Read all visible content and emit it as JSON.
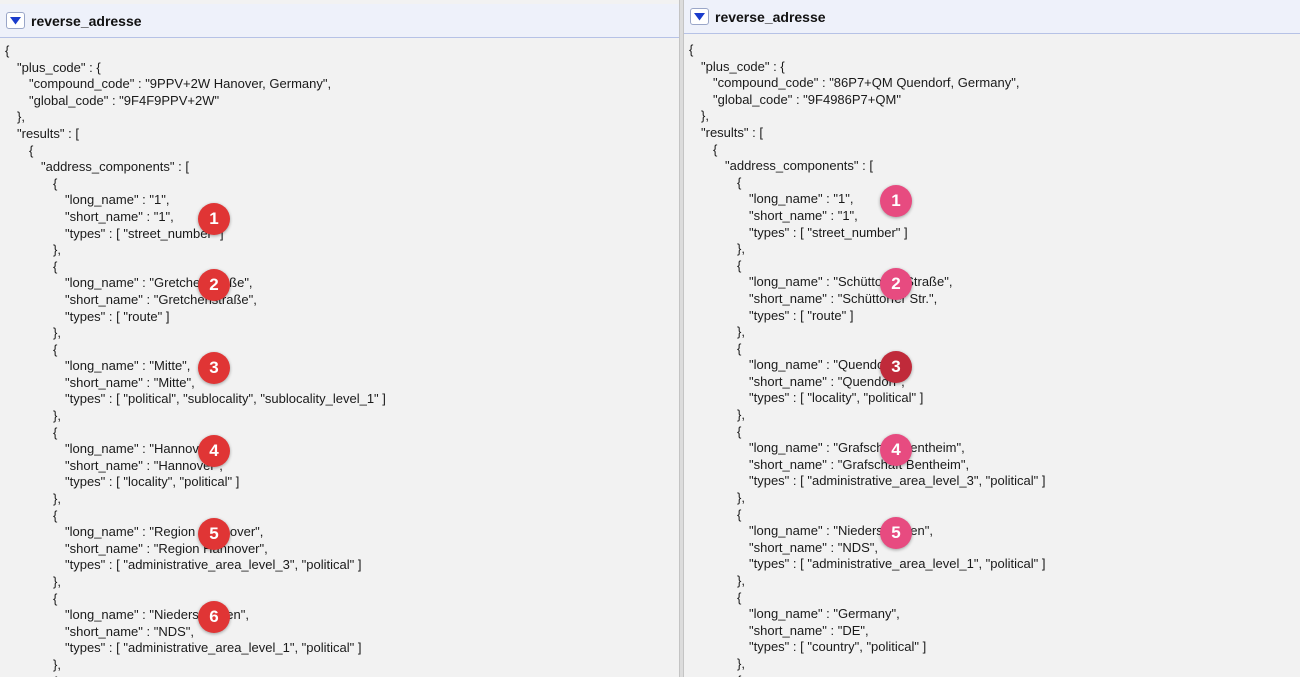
{
  "colors": {
    "marker_left": "#e03535",
    "marker_right": "#e74b80",
    "marker_right_active": "#c02a3a",
    "header_bg": "#eef1fa",
    "header_border": "#b6c2e6",
    "toggle_arrow": "#1a3ccc"
  },
  "panes": [
    {
      "title": "reverse_adresse",
      "toggle_icon": "triangle-down-icon",
      "lines": [
        {
          "indent": 0,
          "text": "{"
        },
        {
          "indent": 1,
          "text": "\"plus_code\" : {"
        },
        {
          "indent": 2,
          "text": "\"compound_code\" : \"9PPV+2W Hanover, Germany\","
        },
        {
          "indent": 2,
          "text": "\"global_code\" : \"9F4F9PPV+2W\""
        },
        {
          "indent": 1,
          "text": "},"
        },
        {
          "indent": 1,
          "text": "\"results\" : ["
        },
        {
          "indent": 2,
          "text": "{"
        },
        {
          "indent": 3,
          "text": "\"address_components\" : ["
        },
        {
          "indent": 4,
          "text": "{"
        },
        {
          "indent": 5,
          "text": "\"long_name\" : \"1\","
        },
        {
          "indent": 5,
          "text": "\"short_name\" : \"1\","
        },
        {
          "indent": 5,
          "text": "\"types\" : [ \"street_number\" ]"
        },
        {
          "indent": 4,
          "text": "},"
        },
        {
          "indent": 4,
          "text": "{"
        },
        {
          "indent": 5,
          "text": "\"long_name\" : \"Gretchenstraße\","
        },
        {
          "indent": 5,
          "text": "\"short_name\" : \"Gretchenstraße\","
        },
        {
          "indent": 5,
          "text": "\"types\" : [ \"route\" ]"
        },
        {
          "indent": 4,
          "text": "},"
        },
        {
          "indent": 4,
          "text": "{"
        },
        {
          "indent": 5,
          "text": "\"long_name\" : \"Mitte\","
        },
        {
          "indent": 5,
          "text": "\"short_name\" : \"Mitte\","
        },
        {
          "indent": 5,
          "text": "\"types\" : [ \"political\", \"sublocality\", \"sublocality_level_1\" ]"
        },
        {
          "indent": 4,
          "text": "},"
        },
        {
          "indent": 4,
          "text": "{"
        },
        {
          "indent": 5,
          "text": "\"long_name\" : \"Hannover\","
        },
        {
          "indent": 5,
          "text": "\"short_name\" : \"Hannover\","
        },
        {
          "indent": 5,
          "text": "\"types\" : [ \"locality\", \"political\" ]"
        },
        {
          "indent": 4,
          "text": "},"
        },
        {
          "indent": 4,
          "text": "{"
        },
        {
          "indent": 5,
          "text": "\"long_name\" : \"Region Hannover\","
        },
        {
          "indent": 5,
          "text": "\"short_name\" : \"Region Hannover\","
        },
        {
          "indent": 5,
          "text": "\"types\" : [ \"administrative_area_level_3\", \"political\" ]"
        },
        {
          "indent": 4,
          "text": "},"
        },
        {
          "indent": 4,
          "text": "{"
        },
        {
          "indent": 5,
          "text": "\"long_name\" : \"Niedersachsen\","
        },
        {
          "indent": 5,
          "text": "\"short_name\" : \"NDS\","
        },
        {
          "indent": 5,
          "text": "\"types\" : [ \"administrative_area_level_1\", \"political\" ]"
        },
        {
          "indent": 4,
          "text": "},"
        },
        {
          "indent": 4,
          "text": "{"
        }
      ],
      "markers": [
        {
          "label": "1",
          "line": 10
        },
        {
          "label": "2",
          "line": 14
        },
        {
          "label": "3",
          "line": 19
        },
        {
          "label": "4",
          "line": 24
        },
        {
          "label": "5",
          "line": 29
        },
        {
          "label": "6",
          "line": 34
        }
      ]
    },
    {
      "title": "reverse_adresse",
      "toggle_icon": "triangle-down-icon",
      "lines": [
        {
          "indent": 0,
          "text": "{"
        },
        {
          "indent": 1,
          "text": "\"plus_code\" : {"
        },
        {
          "indent": 2,
          "text": "\"compound_code\" : \"86P7+QM Quendorf, Germany\","
        },
        {
          "indent": 2,
          "text": "\"global_code\" : \"9F4986P7+QM\""
        },
        {
          "indent": 1,
          "text": "},"
        },
        {
          "indent": 1,
          "text": "\"results\" : ["
        },
        {
          "indent": 2,
          "text": "{"
        },
        {
          "indent": 3,
          "text": "\"address_components\" : ["
        },
        {
          "indent": 4,
          "text": "{"
        },
        {
          "indent": 5,
          "text": "\"long_name\" : \"1\","
        },
        {
          "indent": 5,
          "text": "\"short_name\" : \"1\","
        },
        {
          "indent": 5,
          "text": "\"types\" : [ \"street_number\" ]"
        },
        {
          "indent": 4,
          "text": "},"
        },
        {
          "indent": 4,
          "text": "{"
        },
        {
          "indent": 5,
          "text": "\"long_name\" : \"Schüttorfer Straße\","
        },
        {
          "indent": 5,
          "text": "\"short_name\" : \"Schüttorfer Str.\","
        },
        {
          "indent": 5,
          "text": "\"types\" : [ \"route\" ]"
        },
        {
          "indent": 4,
          "text": "},"
        },
        {
          "indent": 4,
          "text": "{"
        },
        {
          "indent": 5,
          "text": "\"long_name\" : \"Quendorf\","
        },
        {
          "indent": 5,
          "text": "\"short_name\" : \"Quendorf\","
        },
        {
          "indent": 5,
          "text": "\"types\" : [ \"locality\", \"political\" ]"
        },
        {
          "indent": 4,
          "text": "},"
        },
        {
          "indent": 4,
          "text": "{"
        },
        {
          "indent": 5,
          "text": "\"long_name\" : \"Grafschaft Bentheim\","
        },
        {
          "indent": 5,
          "text": "\"short_name\" : \"Grafschaft Bentheim\","
        },
        {
          "indent": 5,
          "text": "\"types\" : [ \"administrative_area_level_3\", \"political\" ]"
        },
        {
          "indent": 4,
          "text": "},"
        },
        {
          "indent": 4,
          "text": "{"
        },
        {
          "indent": 5,
          "text": "\"long_name\" : \"Niedersachsen\","
        },
        {
          "indent": 5,
          "text": "\"short_name\" : \"NDS\","
        },
        {
          "indent": 5,
          "text": "\"types\" : [ \"administrative_area_level_1\", \"political\" ]"
        },
        {
          "indent": 4,
          "text": "},"
        },
        {
          "indent": 4,
          "text": "{"
        },
        {
          "indent": 5,
          "text": "\"long_name\" : \"Germany\","
        },
        {
          "indent": 5,
          "text": "\"short_name\" : \"DE\","
        },
        {
          "indent": 5,
          "text": "\"types\" : [ \"country\", \"political\" ]"
        },
        {
          "indent": 4,
          "text": "},"
        },
        {
          "indent": 4,
          "text": "{"
        }
      ],
      "markers": [
        {
          "label": "1",
          "line": 9
        },
        {
          "label": "2",
          "line": 14
        },
        {
          "label": "3",
          "line": 19
        },
        {
          "label": "4",
          "line": 24
        },
        {
          "label": "5",
          "line": 29
        }
      ]
    }
  ]
}
